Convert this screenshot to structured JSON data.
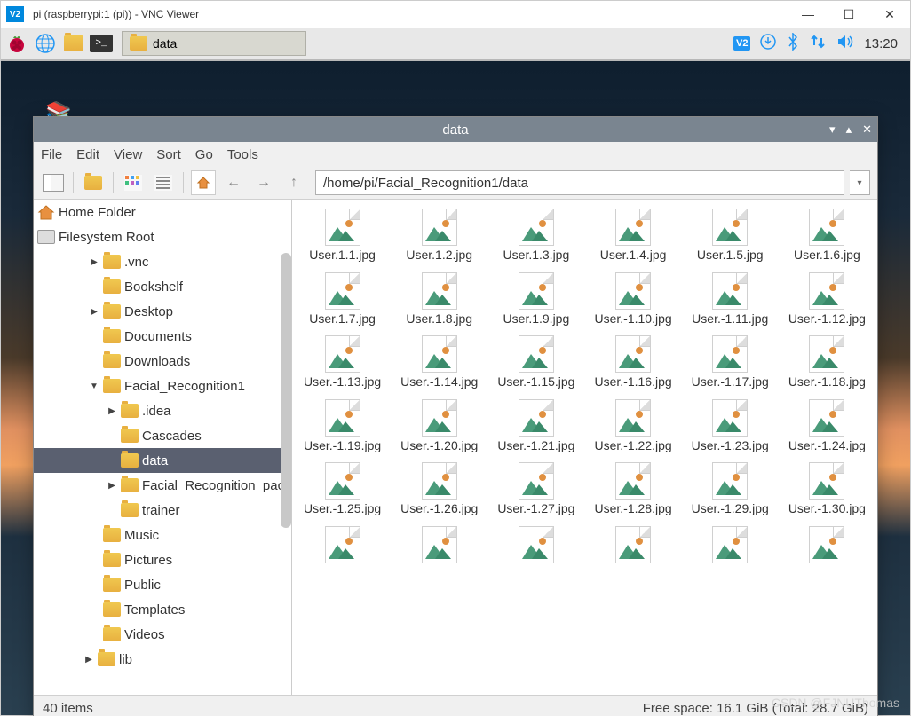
{
  "vnc": {
    "title": "pi (raspberrypi:1 (pi)) - VNC Viewer"
  },
  "taskbar": {
    "task_label": "data",
    "clock": "13:20"
  },
  "file_manager": {
    "title": "data",
    "menu": [
      "File",
      "Edit",
      "View",
      "Sort",
      "Go",
      "Tools"
    ],
    "path": "/home/pi/Facial_Recognition1/data",
    "sidebar": {
      "home": "Home Folder",
      "fs_root": "Filesystem Root",
      "tree": [
        {
          "depth": 1,
          "expand": "▶",
          "name": ".vnc"
        },
        {
          "depth": 1,
          "expand": "",
          "name": "Bookshelf"
        },
        {
          "depth": 1,
          "expand": "▶",
          "name": "Desktop"
        },
        {
          "depth": 1,
          "expand": "",
          "name": "Documents"
        },
        {
          "depth": 1,
          "expand": "",
          "name": "Downloads"
        },
        {
          "depth": 1,
          "expand": "▼",
          "name": "Facial_Recognition1"
        },
        {
          "depth": 2,
          "expand": "▶",
          "name": ".idea"
        },
        {
          "depth": 2,
          "expand": "",
          "name": "Cascades"
        },
        {
          "depth": 2,
          "expand": "",
          "name": "data",
          "selected": true
        },
        {
          "depth": 2,
          "expand": "▶",
          "name": "Facial_Recognition_pac"
        },
        {
          "depth": 2,
          "expand": "",
          "name": "trainer"
        },
        {
          "depth": 1,
          "expand": "",
          "name": "Music"
        },
        {
          "depth": 1,
          "expand": "",
          "name": "Pictures"
        },
        {
          "depth": 1,
          "expand": "",
          "name": "Public"
        },
        {
          "depth": 1,
          "expand": "",
          "name": "Templates"
        },
        {
          "depth": 1,
          "expand": "",
          "name": "Videos"
        },
        {
          "depth": 0,
          "expand": "▶",
          "name": "lib",
          "base": true
        }
      ]
    },
    "files": [
      "User.1.1.jpg",
      "User.1.2.jpg",
      "User.1.3.jpg",
      "User.1.4.jpg",
      "User.1.5.jpg",
      "User.1.6.jpg",
      "User.1.7.jpg",
      "User.1.8.jpg",
      "User.1.9.jpg",
      "User.-1.10.jpg",
      "User.-1.11.jpg",
      "User.-1.12.jpg",
      "User.-1.13.jpg",
      "User.-1.14.jpg",
      "User.-1.15.jpg",
      "User.-1.16.jpg",
      "User.-1.17.jpg",
      "User.-1.18.jpg",
      "User.-1.19.jpg",
      "User.-1.20.jpg",
      "User.-1.21.jpg",
      "User.-1.22.jpg",
      "User.-1.23.jpg",
      "User.-1.24.jpg",
      "User.-1.25.jpg",
      "User.-1.26.jpg",
      "User.-1.27.jpg",
      "User.-1.28.jpg",
      "User.-1.29.jpg",
      "User.-1.30.jpg",
      "",
      "",
      "",
      "",
      "",
      ""
    ],
    "status": {
      "items": "40 items",
      "space": "Free space: 16.1 GiB (Total: 28.7 GiB)"
    }
  },
  "watermark": "CSDN @FJNUThomas"
}
